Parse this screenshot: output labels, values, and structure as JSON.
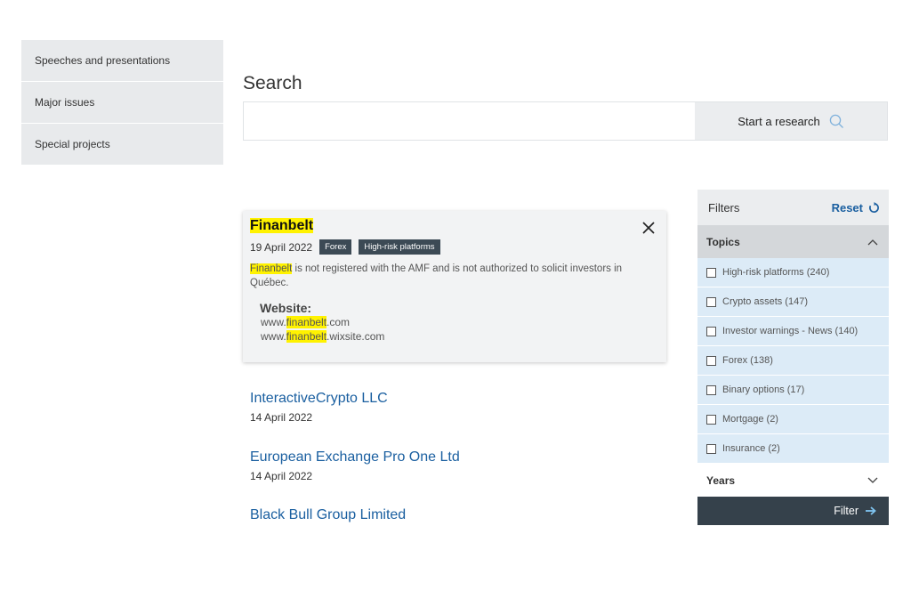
{
  "sidebar": {
    "items": [
      {
        "label": "Speeches and presentations"
      },
      {
        "label": "Major issues"
      },
      {
        "label": "Special projects"
      }
    ]
  },
  "search": {
    "title": "Search",
    "placeholder": "",
    "button_label": "Start a research"
  },
  "expanded_result": {
    "title": "Finanbelt",
    "date": "19 April 2022",
    "tags": [
      "Forex",
      "High-risk platforms"
    ],
    "desc_highlight": "Finanbelt",
    "desc_rest": " is not registered with the AMF and is not authorized to solicit investors in Québec.",
    "website_label": "Website:",
    "urls": [
      {
        "prefix": "www.",
        "highlight": "finanbelt",
        "suffix": ".com"
      },
      {
        "prefix": "www.",
        "highlight": "finanbelt",
        "suffix": ".wixsite.com"
      }
    ]
  },
  "results": [
    {
      "title": "InteractiveCrypto LLC",
      "date": "14 April 2022"
    },
    {
      "title": "European Exchange Pro One Ltd",
      "date": "14 April 2022"
    },
    {
      "title": "Black Bull Group Limited",
      "date": ""
    }
  ],
  "filters": {
    "title": "Filters",
    "reset_label": "Reset",
    "topics_label": "Topics",
    "topics": [
      {
        "label": "High-risk platforms (240)",
        "checked": false
      },
      {
        "label": "Crypto assets (147)",
        "checked": false
      },
      {
        "label": "Investor warnings - News (140)",
        "checked": false
      },
      {
        "label": "Forex (138)",
        "checked": false
      },
      {
        "label": "Binary options (17)",
        "checked": false
      },
      {
        "label": "Mortgage (2)",
        "checked": false
      },
      {
        "label": "Insurance (2)",
        "checked": false
      }
    ],
    "years_label": "Years",
    "filter_button": "Filter"
  },
  "colors": {
    "link": "#1a5fa0",
    "highlight": "#fff200",
    "tag_bg": "#3c4a55",
    "topic_bg": "#dcebf7",
    "filter_button_bg": "#35414b"
  }
}
